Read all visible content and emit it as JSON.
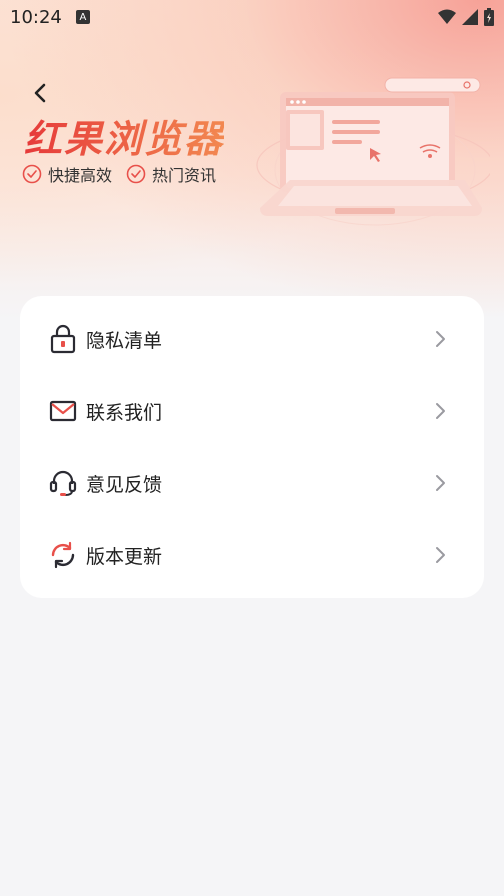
{
  "status": {
    "time": "10:24",
    "notif_badge": "A"
  },
  "header": {
    "title": "红果浏览器",
    "features": [
      {
        "label": "快捷高效",
        "icon": "check-circle-icon"
      },
      {
        "label": "热门资讯",
        "icon": "check-circle-icon"
      }
    ]
  },
  "menu": {
    "items": [
      {
        "label": "隐私清单",
        "icon": "lock-icon"
      },
      {
        "label": "联系我们",
        "icon": "mail-icon"
      },
      {
        "label": "意见反馈",
        "icon": "headset-icon"
      },
      {
        "label": "版本更新",
        "icon": "refresh-icon"
      }
    ]
  },
  "colors": {
    "accent": "#e8504a",
    "icon_dark": "#2b2b33",
    "background": "#f5f5f7"
  }
}
